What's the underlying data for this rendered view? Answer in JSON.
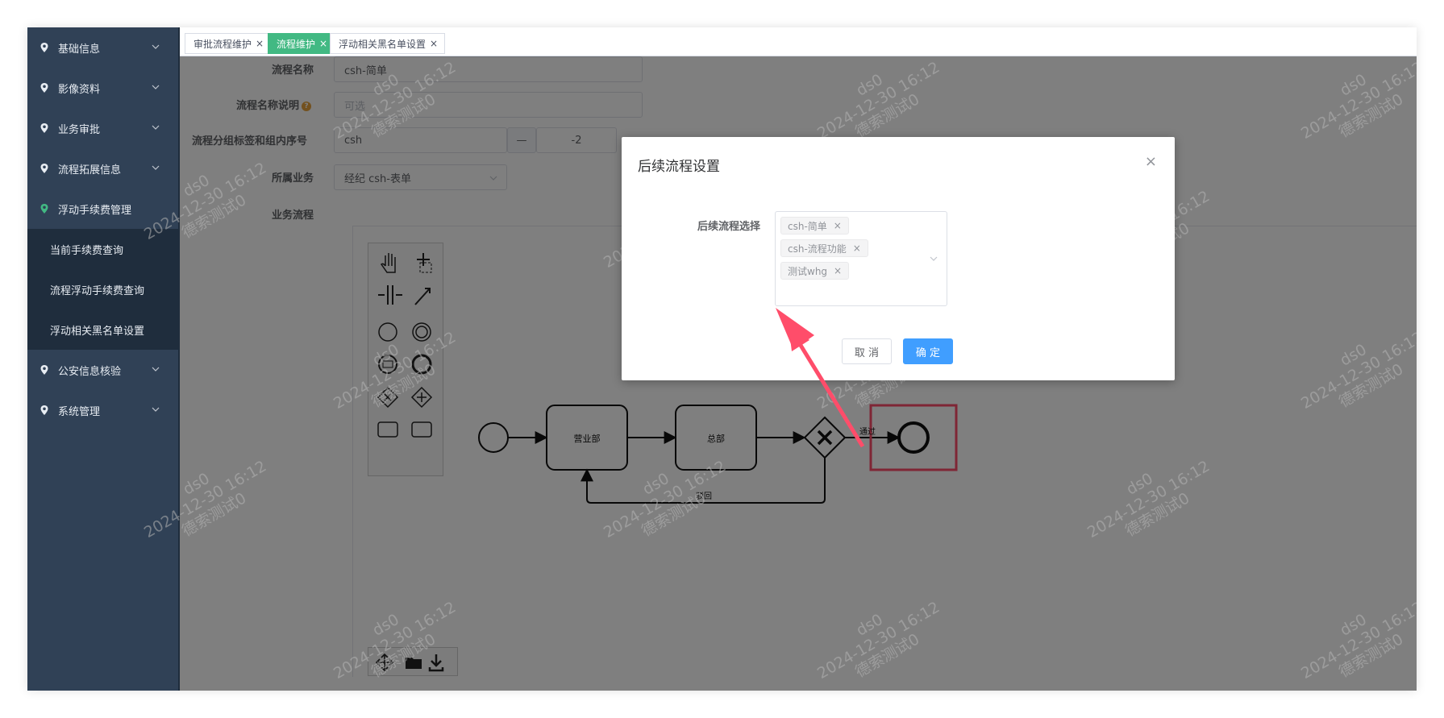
{
  "sidebar": {
    "items": [
      {
        "label": "基础信息"
      },
      {
        "label": "影像资料"
      },
      {
        "label": "业务审批"
      },
      {
        "label": "流程拓展信息"
      },
      {
        "label": "浮动手续费管理"
      }
    ],
    "sub_items": [
      {
        "label": "当前手续费查询"
      },
      {
        "label": "流程浮动手续费查询"
      },
      {
        "label": "浮动相关黑名单设置"
      }
    ],
    "items_after": [
      {
        "label": "公安信息核验"
      },
      {
        "label": "系统管理"
      }
    ],
    "active_pin_color": "#42b983"
  },
  "tabs": [
    {
      "label": "审批流程维护"
    },
    {
      "label": "流程维护"
    },
    {
      "label": "浮动相关黑名单设置"
    }
  ],
  "form": {
    "name_label": "流程名称",
    "name_value": "csh-简单",
    "desc_label": "流程名称说明",
    "desc_placeholder": "可选",
    "group_label": "流程分组标签和组内序号",
    "group_value": "csh",
    "stepper_minus": "—",
    "stepper_value": "-2",
    "business_label": "所属业务",
    "business_value": "经纪 csh-表单",
    "flow_label": "业务流程"
  },
  "diagram": {
    "task1": "营业部",
    "task2": "总部",
    "pass_label": "通过",
    "reject_label": "驳回"
  },
  "dialog": {
    "title": "后续流程设置",
    "field_label": "后续流程选择",
    "chips": [
      "csh-简单",
      "csh-流程功能",
      "测试whg"
    ],
    "cancel": "取 消",
    "confirm": "确 定"
  },
  "watermark": {
    "user": "ds0",
    "time": "2024-12-30 16:12",
    "name": "德索测试0"
  },
  "colors": {
    "sidebar_bg": "#304156",
    "tab_active": "#42b983",
    "primary": "#409eff",
    "highlight": "#ff4d6a"
  }
}
